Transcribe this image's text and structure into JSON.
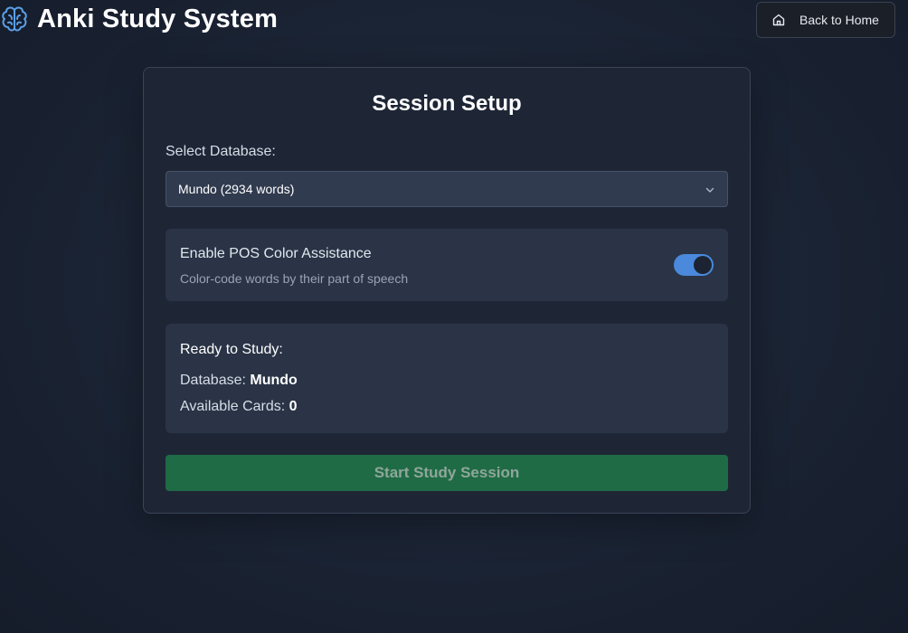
{
  "header": {
    "title": "Anki Study System",
    "brand_icon": "brain-icon",
    "home_button": {
      "label": "Back to Home",
      "icon": "home-icon"
    }
  },
  "setup": {
    "title": "Session Setup",
    "database_label": "Select Database:",
    "database_selected": "Mundo (2934 words)",
    "pos": {
      "title": "Enable POS Color Assistance",
      "description": "Color-code words by their part of speech",
      "enabled": true
    },
    "ready": {
      "title": "Ready to Study:",
      "database_label": "Database: ",
      "database_value": "Mundo",
      "cards_label": "Available Cards: ",
      "cards_value": "0"
    },
    "start_button": "Start Study Session",
    "start_button_enabled": false
  },
  "colors": {
    "accent": "#4a89dc",
    "start_button": "#1f6b45",
    "background": "#1c2536",
    "card": "#1e2636"
  }
}
